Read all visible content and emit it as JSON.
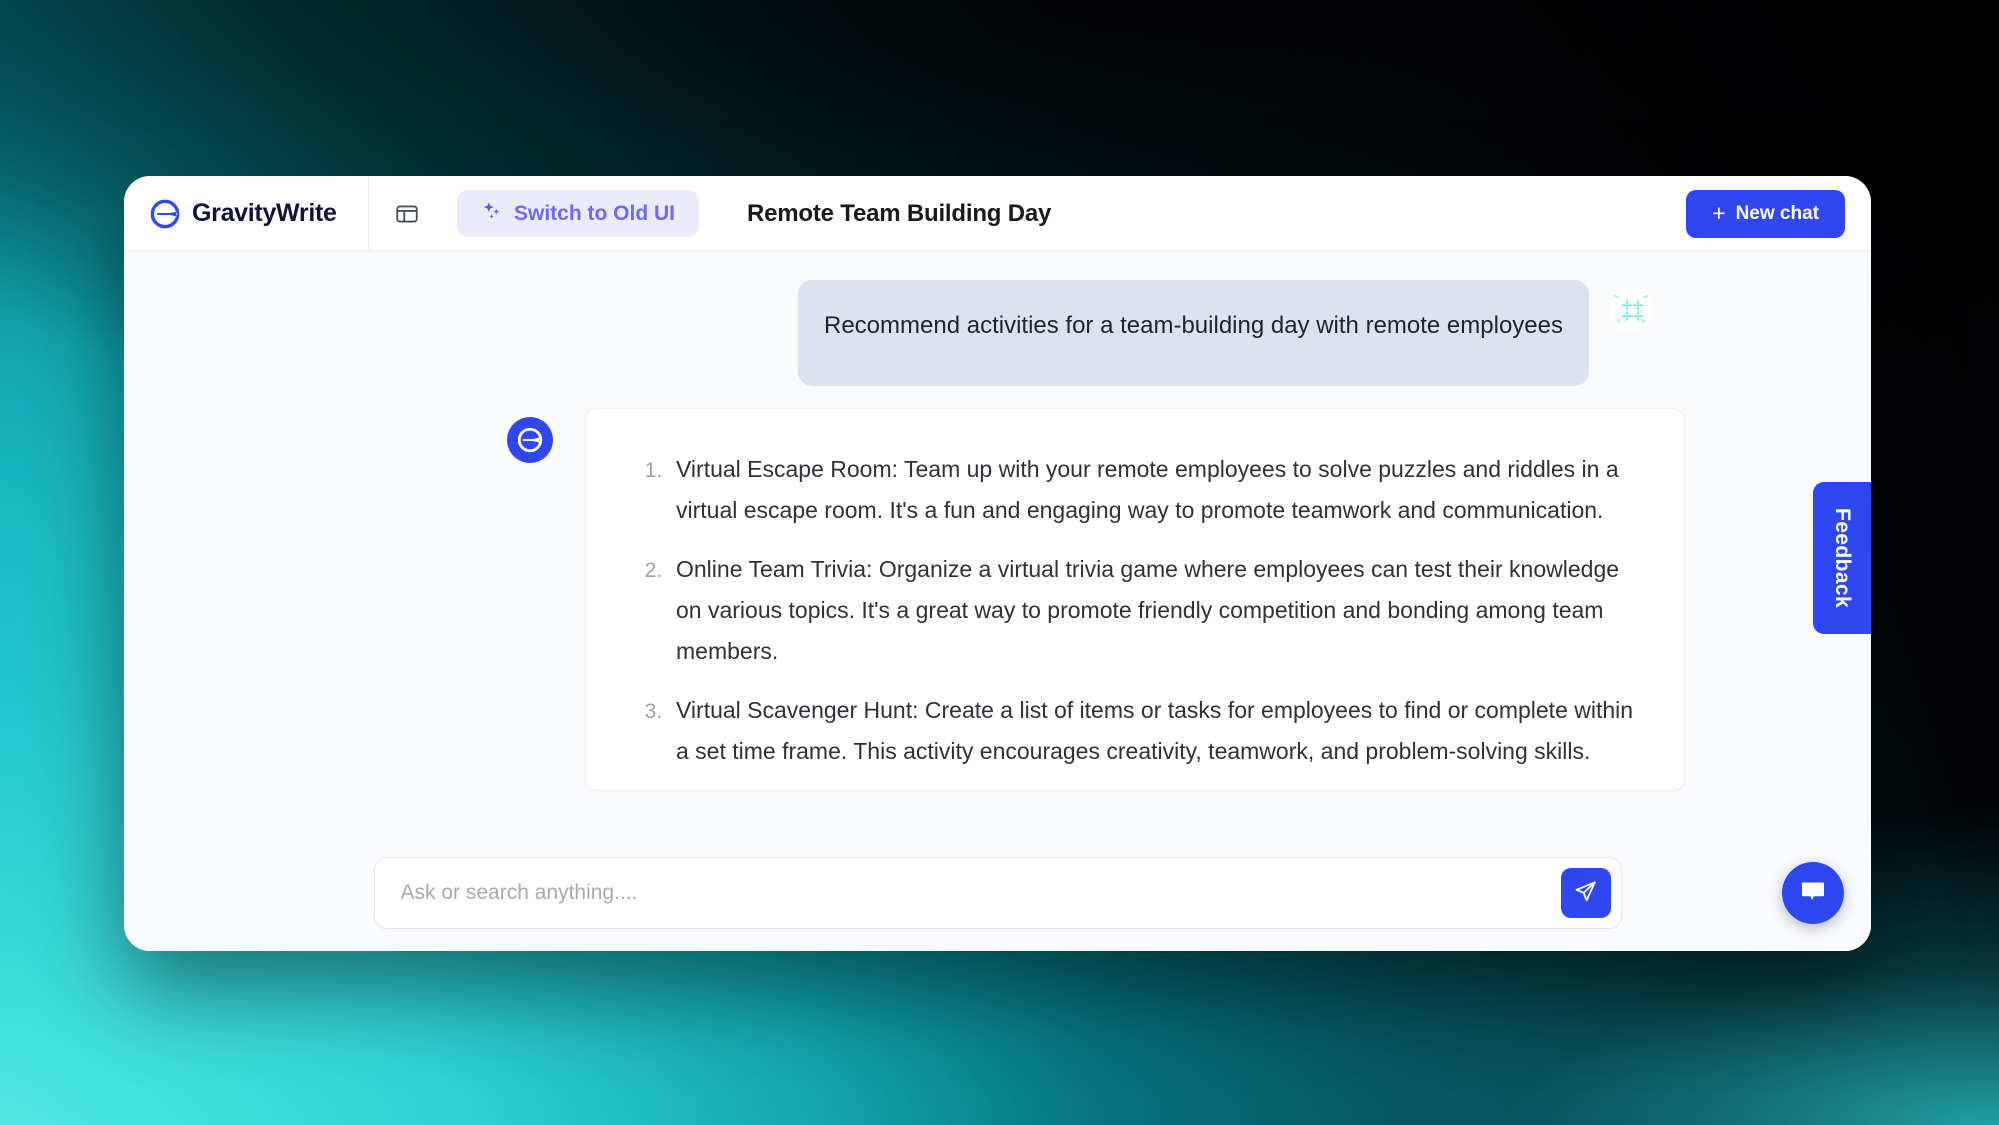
{
  "window": {
    "brand_name": "GravityWrite"
  },
  "topbar": {
    "logo_icon": "gravitywrite-logo-icon",
    "panel_toggle_icon": "sidebar-panel-icon",
    "switch_old_ui": {
      "label": "Switch to Old UI",
      "icon": "sparkles-icon",
      "background": "#eceafd",
      "text_color": "#6d6af0"
    },
    "chat_title": "Remote Team Building Day",
    "new_chat": {
      "label": "New chat",
      "plus": "+",
      "background": "#2f47f0"
    }
  },
  "conversation": {
    "user_message": {
      "text": "Recommend activities for a team-building day with remote employees",
      "avatar_icon": "user-sparkle-avatar-icon",
      "bubble_color": "#dde2ef"
    },
    "assistant_message": {
      "avatar_icon": "gravitywrite-avatar-icon",
      "items": [
        "Virtual Escape Room: Team up with your remote employees to solve puzzles and riddles in a virtual escape room. It's a fun and engaging way to promote teamwork and communication.",
        "Online Team Trivia: Organize a virtual trivia game where employees can test their knowledge on various topics. It's a great way to promote friendly competition and bonding among team members.",
        "Virtual Scavenger Hunt: Create a list of items or tasks for employees to find or complete within a set time frame. This activity encourages creativity, teamwork, and problem-solving skills."
      ]
    },
    "scroll_down_icon": "arrow-down-icon"
  },
  "composer": {
    "placeholder": "Ask or search anything....",
    "value": "",
    "send_icon": "send-paper-plane-icon"
  },
  "feedback_tab": {
    "label": "Feedback",
    "background": "#2f47f0"
  },
  "support": {
    "icon": "chat-bubble-icon",
    "background": "#2f47f0"
  },
  "theme": {
    "accent": "#2f47f0",
    "backdrop_teal": "#2ed0d6",
    "backdrop_dark": "#000000",
    "user_avatar_teal": "#2fe6d8"
  }
}
